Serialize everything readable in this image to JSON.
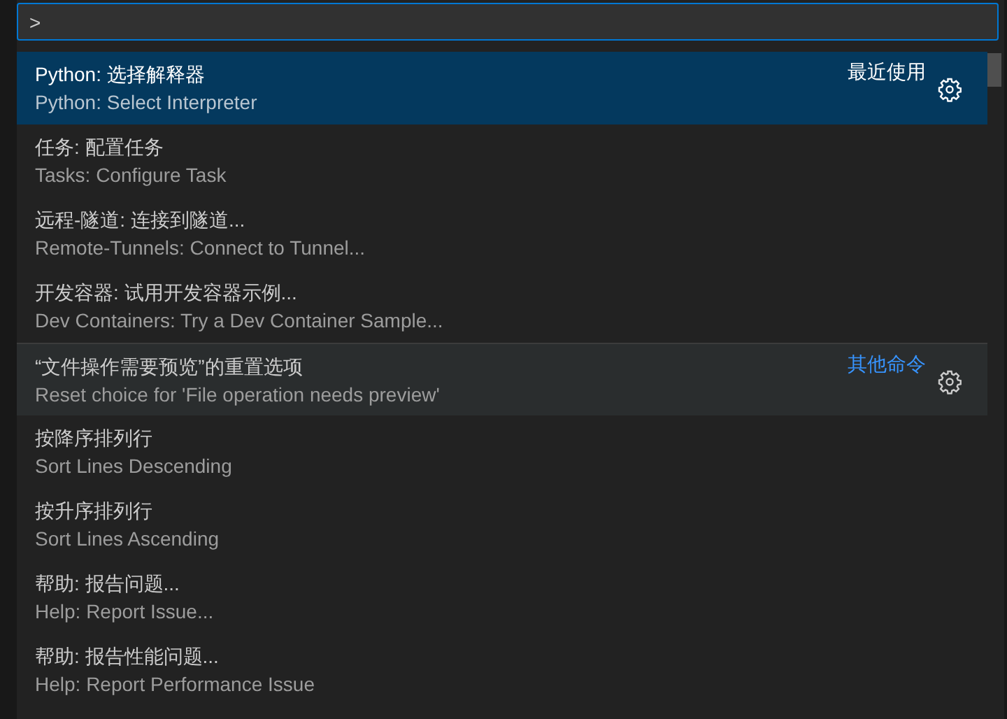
{
  "input": {
    "value": ">"
  },
  "items": [
    {
      "label": "Python: 选择解释器",
      "detail": "Python: Select Interpreter",
      "selected": true,
      "hovered": false,
      "group": "最近使用",
      "separator": false,
      "gear": true
    },
    {
      "label": "任务: 配置任务",
      "detail": "Tasks: Configure Task",
      "selected": false,
      "hovered": false,
      "separator": false,
      "gear": false
    },
    {
      "label": "远程-隧道: 连接到隧道...",
      "detail": "Remote-Tunnels: Connect to Tunnel...",
      "selected": false,
      "hovered": false,
      "separator": false,
      "gear": false
    },
    {
      "label": "开发容器: 试用开发容器示例...",
      "detail": "Dev Containers: Try a Dev Container Sample...",
      "selected": false,
      "hovered": false,
      "separator": false,
      "gear": false
    },
    {
      "label": "“文件操作需要预览”的重置选项",
      "detail": "Reset choice for 'File operation needs preview'",
      "selected": false,
      "hovered": true,
      "group": "其他命令",
      "separator": true,
      "gear": true
    },
    {
      "label": "按降序排列行",
      "detail": "Sort Lines Descending",
      "selected": false,
      "hovered": false,
      "separator": false,
      "gear": false
    },
    {
      "label": "按升序排列行",
      "detail": "Sort Lines Ascending",
      "selected": false,
      "hovered": false,
      "separator": false,
      "gear": false
    },
    {
      "label": "帮助: 报告问题...",
      "detail": "Help: Report Issue...",
      "selected": false,
      "hovered": false,
      "separator": false,
      "gear": false
    },
    {
      "label": "帮助: 报告性能问题...",
      "detail": "Help: Report Performance Issue",
      "selected": false,
      "hovered": false,
      "separator": false,
      "gear": false
    }
  ]
}
